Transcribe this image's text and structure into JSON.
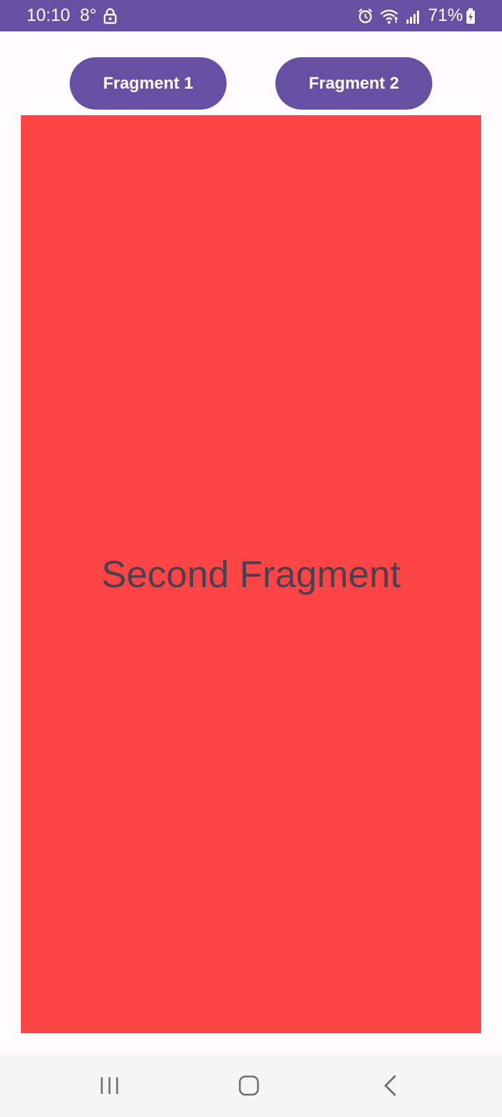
{
  "status_bar": {
    "time": "10:10",
    "temperature": "8°",
    "battery_percent": "71%",
    "background_color": "#6750a4",
    "icons": [
      "lock-icon",
      "alarm-icon",
      "wifi-icon",
      "signal-icon",
      "battery-icon"
    ]
  },
  "buttons": {
    "fragment1_label": "Fragment 1",
    "fragment2_label": "Fragment 2",
    "color": "#6750a4"
  },
  "fragment": {
    "label": "Second Fragment",
    "background_color": "#fe4545",
    "text_color": "#4d3f4e"
  },
  "nav_bar": {
    "icons": [
      "recents-icon",
      "home-icon",
      "back-icon"
    ]
  }
}
